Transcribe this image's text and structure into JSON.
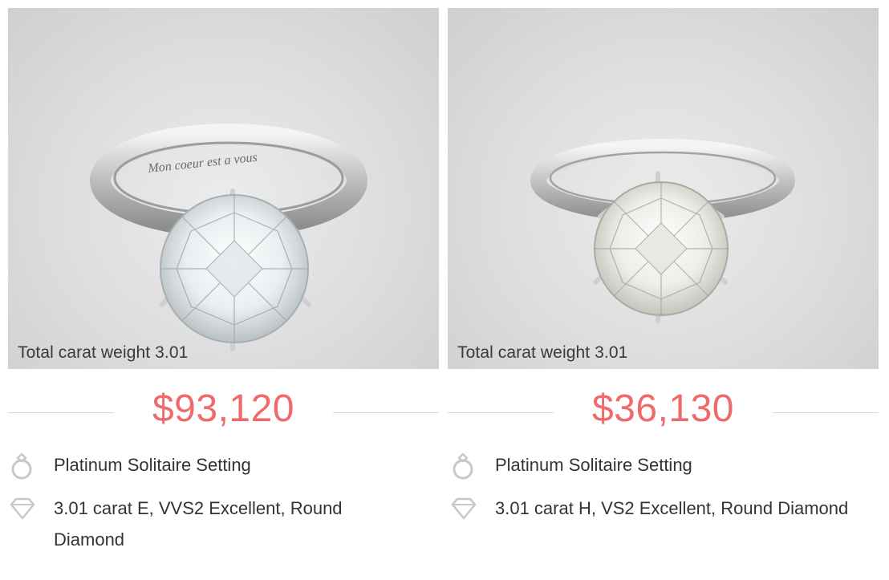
{
  "products": [
    {
      "total_weight": "Total carat weight 3.01",
      "price": "$93,120",
      "engraving": "Mon coeur est a vous",
      "setting": "Platinum Solitaire Setting",
      "diamond": "3.01 carat E, VVS2 Excellent, Round Diamond"
    },
    {
      "total_weight": "Total carat weight 3.01",
      "price": "$36,130",
      "setting": "Platinum Solitaire Setting",
      "diamond": "3.01 carat H, VS2 Excellent, Round Diamond"
    }
  ],
  "icons": {
    "setting": "ring-icon",
    "diamond": "diamond-icon"
  },
  "colors": {
    "price": "#ef6a6a",
    "divider": "#d6d6d6",
    "icon": "#c8c8c8"
  }
}
